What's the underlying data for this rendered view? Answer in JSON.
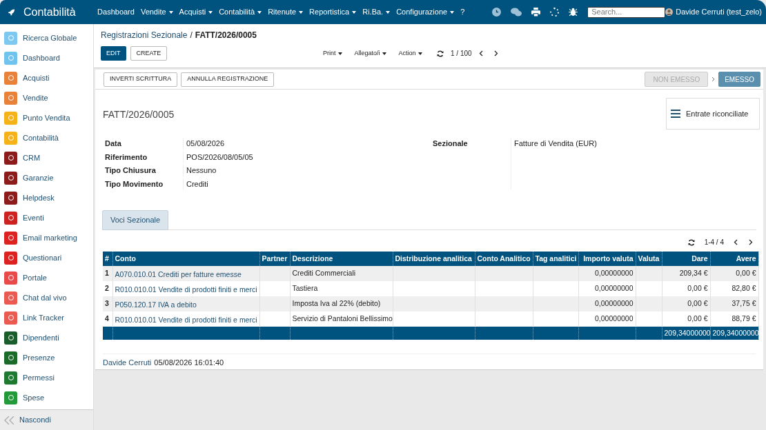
{
  "app_title": "Contabilità",
  "menu": [
    {
      "label": "Dashboard",
      "dropdown": false
    },
    {
      "label": "Vendite",
      "dropdown": true
    },
    {
      "label": "Acquisti",
      "dropdown": true
    },
    {
      "label": "Contabilità",
      "dropdown": true
    },
    {
      "label": "Ritenute",
      "dropdown": true
    },
    {
      "label": "Reportistica",
      "dropdown": true
    },
    {
      "label": "Ri.Ba.",
      "dropdown": true
    },
    {
      "label": "Configurazione",
      "dropdown": true
    },
    {
      "label": "?",
      "dropdown": false
    }
  ],
  "search": {
    "placeholder": "Search..."
  },
  "user": "Davide Cerruti (test_zelo)",
  "sidebar": {
    "items": [
      {
        "label": "Ricerca Globale",
        "color": "#7cc8f0"
      },
      {
        "label": "Dashboard",
        "color": "#6fc3ec"
      },
      {
        "label": "Acquisti",
        "color": "#e8813a"
      },
      {
        "label": "Vendite",
        "color": "#e8813a"
      },
      {
        "label": "Punto Vendita",
        "color": "#f6b319"
      },
      {
        "label": "Contabilità",
        "color": "#f6b319"
      },
      {
        "label": "CRM",
        "color": "#8c1c1c"
      },
      {
        "label": "Garanzie",
        "color": "#8c1c1c"
      },
      {
        "label": "Helpdesk",
        "color": "#8c1c1c"
      },
      {
        "label": "Eventi",
        "color": "#cc2222"
      },
      {
        "label": "Email marketing",
        "color": "#dd2222"
      },
      {
        "label": "Questionari",
        "color": "#dd2222"
      },
      {
        "label": "Portale",
        "color": "#e84a4a"
      },
      {
        "label": "Chat dal vivo",
        "color": "#ea5a50"
      },
      {
        "label": "Link Tracker",
        "color": "#ea5a50"
      },
      {
        "label": "Dipendenti",
        "color": "#1a5c2a"
      },
      {
        "label": "Presenze",
        "color": "#1a6a2a"
      },
      {
        "label": "Permessi",
        "color": "#1d7a30"
      },
      {
        "label": "Spese",
        "color": "#239a3a"
      }
    ],
    "collapse_label": "Nascondi"
  },
  "breadcrumb": [
    {
      "label": "Registrazioni Sezionale"
    },
    {
      "label": "FATT/2026/0005"
    }
  ],
  "breadcrumb_separator": "/",
  "buttons": [
    {
      "label": "EDIT",
      "primary": true
    },
    {
      "label": "CREATE",
      "primary": false
    }
  ],
  "actions": [
    "Print",
    "Allegato/i",
    "Action"
  ],
  "pager": "1 / 100",
  "header_buttons": [
    "INVERTI SCRITTURA",
    "ANNULLA REGISTRAZIONE"
  ],
  "status_steps": [
    {
      "label": "NON EMESSO",
      "selected": false
    },
    {
      "label": "EMESSO",
      "selected": true
    }
  ],
  "record_name": "FATT/2026/0005",
  "smart_button": "Entrate riconciliate",
  "fields_left": [
    {
      "label": "Data",
      "value": "05/08/2026"
    },
    {
      "label": "Riferimento",
      "value": "POS/2026/08/05/05"
    },
    {
      "label": "Tipo Chiusura",
      "value": "Nessuno"
    },
    {
      "label": "Tipo Movimento",
      "value": "Crediti"
    }
  ],
  "fields_right": [
    {
      "label": "Sezionale",
      "value": "Fatture di Vendita (EUR)"
    }
  ],
  "tabs": [
    {
      "label": "Voci Sezionale",
      "selected": true
    }
  ],
  "table_pager": "1-4 / 4",
  "table": {
    "columns": [
      "#",
      "Conto",
      "Partner",
      "Descrizione",
      "Distribuzione analitica",
      "Conto Analitico",
      "Tag analitici",
      "Importo valuta",
      "Valuta",
      "Dare",
      "Avere"
    ],
    "rows": [
      [
        "1",
        "A070.010.01 Crediti per fatture emesse",
        "",
        "Crediti Commerciali",
        "",
        "",
        "",
        "0,00000000",
        "",
        "209,34 €",
        "0,00 €"
      ],
      [
        "2",
        "R010.010.01 Vendite di prodotti finiti e merci",
        "",
        "Tastiera",
        "",
        "",
        "",
        "0,00000000",
        "",
        "0,00 €",
        "82,80 €"
      ],
      [
        "3",
        "P050.120.17 IVA a debito",
        "",
        "Imposta Iva al 22% (debito)",
        "",
        "",
        "",
        "0,00000000",
        "",
        "0,00 €",
        "37,75 €"
      ],
      [
        "4",
        "R010.010.01 Vendite di prodotti finiti e merci",
        "",
        "Servizio di Pantaloni Bellissimo",
        "",
        "",
        "",
        "0,00000000",
        "",
        "0,00 €",
        "88,79 €"
      ]
    ],
    "totals": {
      "dare": "209,34000000",
      "avere": "209,34000000"
    }
  },
  "footer": {
    "author": "Davide Cerruti",
    "timestamp": "05/08/2026 16:01:40"
  }
}
